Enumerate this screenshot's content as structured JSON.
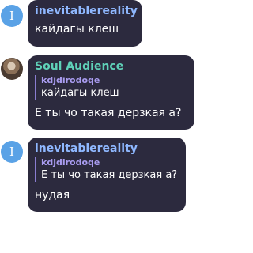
{
  "messages": [
    {
      "avatar_initial": "I",
      "author": "inevitablereality",
      "author_color": "#8fb8ff",
      "text": "кайдагы клеш"
    },
    {
      "avatar_icon": "user-photo-avatar",
      "author": "Soul Audience",
      "author_color": "#5fd1b8",
      "reply_to": {
        "author": "kdjdirodoqe",
        "text": "кайдагы клеш"
      },
      "text": "Е ты чо такая дерзкая а?"
    },
    {
      "avatar_initial": "I",
      "author": "inevitablereality",
      "author_color": "#8fb8ff",
      "reply_to": {
        "author": "kdjdirodoqe",
        "text": "Е ты чо такая дерзкая а?"
      },
      "text": "нудая"
    }
  ]
}
